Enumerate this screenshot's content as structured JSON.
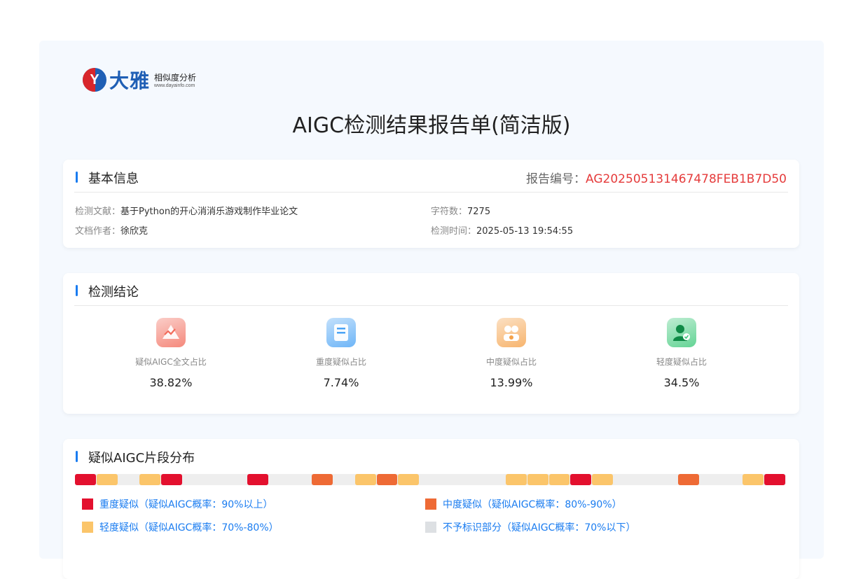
{
  "logo": {
    "cn": "大雅",
    "sub_cn": "相似度分析",
    "sub_url": "www.dayainfo.com",
    "mark_letter": "Y"
  },
  "title": "AIGC检测结果报告单(简洁版)",
  "basic": {
    "heading": "基本信息",
    "report_no_label": "报告编号：",
    "report_no": "AG202505131467478FEB1B7D50",
    "doc_label": "检测文献：",
    "doc": "基于Python的开心消消乐游戏制作毕业论文",
    "author_label": "文档作者：",
    "author": "徐欣克",
    "chars_label": "字符数：",
    "chars": "7275",
    "time_label": "检测时间：",
    "time": "2025-05-13 19:54:55"
  },
  "conclusion": {
    "heading": "检测结论",
    "stats": [
      {
        "label": "疑似AIGC全文占比",
        "value": "38.82%",
        "icon": "warning-chart-icon",
        "color": "#f26b5b"
      },
      {
        "label": "重度疑似占比",
        "value": "7.74%",
        "icon": "document-icon",
        "color": "#4aa3f5"
      },
      {
        "label": "中度疑似占比",
        "value": "13.99%",
        "icon": "users-icon",
        "color": "#f5a24a"
      },
      {
        "label": "轻度疑似占比",
        "value": "34.5%",
        "icon": "user-check-icon",
        "color": "#3dc97a"
      }
    ]
  },
  "distribution": {
    "heading": "疑似AIGC片段分布",
    "colors": {
      "heavy": "#e3102e",
      "medium": "#ee6a35",
      "light": "#fbc56a",
      "none": "#eeeeee"
    },
    "segments": [
      "heavy",
      "light",
      "none",
      "light",
      "heavy",
      "none",
      "none",
      "none",
      "heavy",
      "none",
      "none",
      "medium",
      "none",
      "light",
      "medium",
      "light",
      "none",
      "none",
      "none",
      "none",
      "light",
      "light",
      "light",
      "heavy",
      "light",
      "none",
      "none",
      "none",
      "medium",
      "none",
      "none",
      "light",
      "heavy"
    ],
    "legend": [
      {
        "key": "heavy",
        "label": "重度疑似（疑似AIGC概率：90%以上）"
      },
      {
        "key": "medium",
        "label": "中度疑似（疑似AIGC概率：80%-90%）"
      },
      {
        "key": "light",
        "label": "轻度疑似（疑似AIGC概率：70%-80%）"
      },
      {
        "key": "none",
        "label": "不予标识部分（疑似AIGC概率：70%以下）"
      }
    ]
  }
}
